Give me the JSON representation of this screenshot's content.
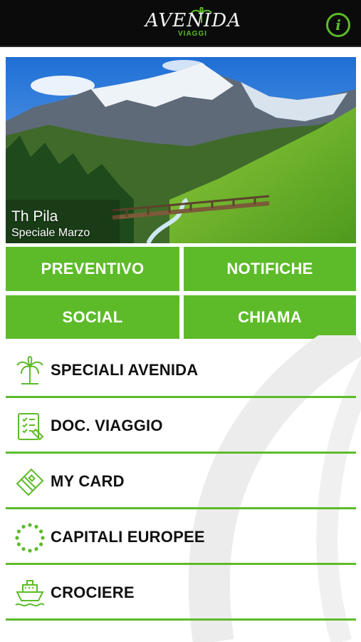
{
  "header": {
    "logo_wordmark": "AVENIDA",
    "logo_subtext": "VIAGGI",
    "info_icon": "info-icon",
    "info_glyph": "i"
  },
  "banner": {
    "title": "Th Pila",
    "subtitle": "Speciale Marzo"
  },
  "tiles": [
    {
      "label": "PREVENTIVO"
    },
    {
      "label": "NOTIFICHE"
    },
    {
      "label": "SOCIAL"
    },
    {
      "label": "CHIAMA"
    }
  ],
  "menu": [
    {
      "label": "SPECIALI AVENIDA",
      "icon": "palm-tree-icon"
    },
    {
      "label": "DOC. VIAGGIO",
      "icon": "document-icon"
    },
    {
      "label": "MY CARD",
      "icon": "card-icon"
    },
    {
      "label": "CAPITALI EUROPEE",
      "icon": "eu-stars-icon"
    },
    {
      "label": "CROCIERE",
      "icon": "cruise-ship-icon"
    }
  ],
  "colors": {
    "accent": "#5dbb2a",
    "header_bg": "#0b0b0b",
    "text": "#111111"
  }
}
